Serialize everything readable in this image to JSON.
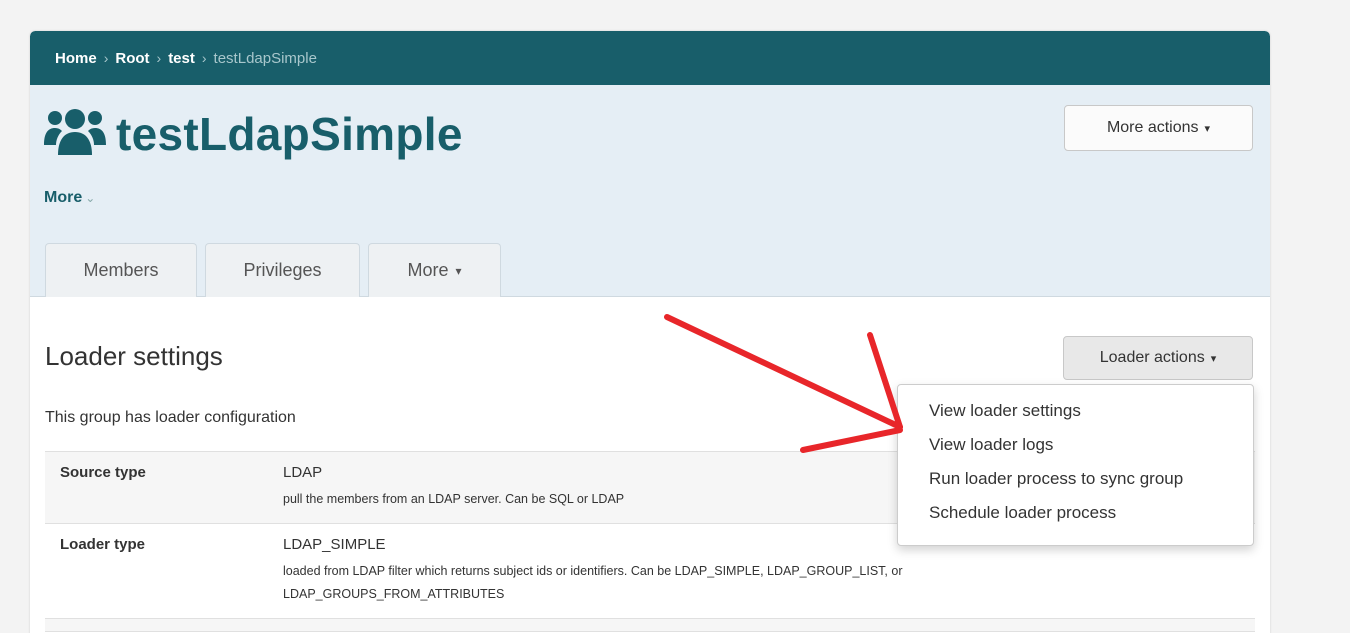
{
  "breadcrumb": {
    "items": [
      "Home",
      "Root",
      "test"
    ],
    "current": "testLdapSimple",
    "separator": "›"
  },
  "group": {
    "title": "testLdapSimple",
    "icon": "users-icon",
    "more_label": "More",
    "more_chevron": "⌄"
  },
  "header_actions": {
    "more_actions_label": "More actions",
    "caret": "▾"
  },
  "tabs": [
    {
      "label": "Members"
    },
    {
      "label": "Privileges"
    },
    {
      "label": "More",
      "caret": "▾"
    }
  ],
  "loader": {
    "section_title": "Loader settings",
    "actions_label": "Loader actions",
    "description": "This group has loader configuration",
    "rows": [
      {
        "label": "Source type",
        "value": "LDAP",
        "note": "pull the members from an LDAP server. Can be SQL or LDAP"
      },
      {
        "label": "Loader type",
        "value": "LDAP_SIMPLE",
        "note": "loaded from LDAP filter which returns subject ids or identifiers. Can be LDAP_SIMPLE, LDAP_GROUP_LIST, or LDAP_GROUPS_FROM_ATTRIBUTES"
      }
    ]
  },
  "dropdown": {
    "items": [
      "View loader settings",
      "View loader logs",
      "Run loader process to sync group",
      "Schedule loader process"
    ]
  },
  "colors": {
    "brand": "#185e6a",
    "header_bg": "#e5eef5",
    "annotation_arrow": "#e8262a"
  }
}
